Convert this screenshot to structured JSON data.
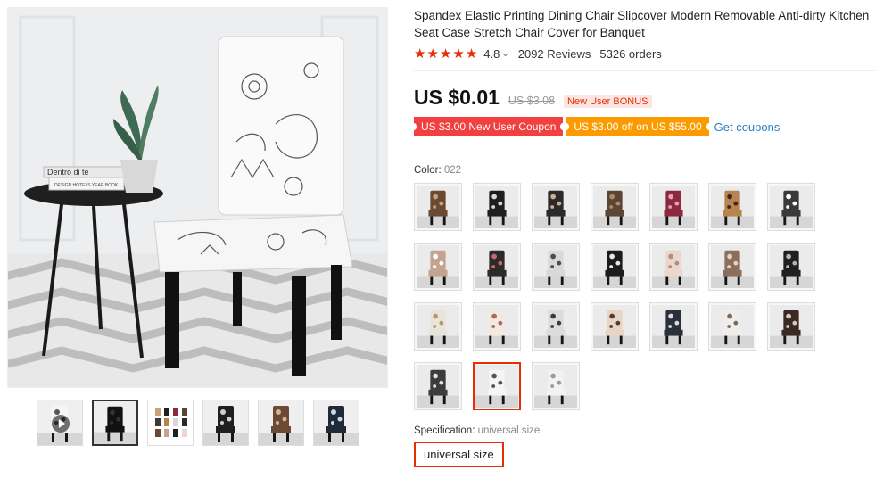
{
  "gallery": {
    "thumbnails": [
      {
        "name": "thumb-video",
        "kind": "video"
      },
      {
        "name": "thumb-black-chair",
        "kind": "image"
      },
      {
        "name": "thumb-size-chart",
        "kind": "image"
      },
      {
        "name": "thumb-floral-dark",
        "kind": "image"
      },
      {
        "name": "thumb-floral-brown",
        "kind": "image"
      },
      {
        "name": "thumb-floral-navy",
        "kind": "image"
      }
    ],
    "main_image_text": {
      "book_title": "Dentro di te",
      "book_subtitle": "DESIGN HOTELS YEAR BOOK"
    }
  },
  "product": {
    "title": "Spandex Elastic Printing Dining Chair Slipcover Modern Removable Anti-dirty Kitchen Seat Case Stretch Chair Cover for Banquet",
    "rating": "4.8",
    "rating_caret": "⌄",
    "reviews": "2092 Reviews",
    "orders": "5326 orders",
    "star_count": 5,
    "star_color": "#e62e04"
  },
  "price": {
    "current": "US $0.01",
    "original": "US $3.08",
    "bonus": "New User BONUS"
  },
  "coupons": {
    "items": [
      {
        "label": "US $3.00 New User Coupon",
        "color": "#f23f3f"
      },
      {
        "label": "US $3.00 off on US $55.00",
        "color": "#fb9b00"
      }
    ],
    "link": "Get coupons"
  },
  "color": {
    "label": "Color:",
    "value": "022",
    "options": [
      {
        "bg": "#6b4a34",
        "fg": "#c9a27a"
      },
      {
        "bg": "#1e1e1e",
        "fg": "#d9d9d9"
      },
      {
        "bg": "#2a2a2a",
        "fg": "#c8b08a"
      },
      {
        "bg": "#5b4636",
        "fg": "#b08b6a"
      },
      {
        "bg": "#8c2940",
        "fg": "#e5a0b5"
      },
      {
        "bg": "#b7834f",
        "fg": "#3a2a20"
      },
      {
        "bg": "#3a3a3a",
        "fg": "#ffffff"
      },
      {
        "bg": "#c4a48e",
        "fg": "#ffffff"
      },
      {
        "bg": "#2b2b2b",
        "fg": "#c76a6a"
      },
      {
        "bg": "#d9d9d9",
        "fg": "#4d4d4d"
      },
      {
        "bg": "#1c1c1c",
        "fg": "#e8e8e8"
      },
      {
        "bg": "#ead8cf",
        "fg": "#c08a7a"
      },
      {
        "bg": "#8c6e5a",
        "fg": "#e2d4c6"
      },
      {
        "bg": "#202020",
        "fg": "#b5b5b5"
      },
      {
        "bg": "#e8e4dc",
        "fg": "#b59a68"
      },
      {
        "bg": "#f2e9e1",
        "fg": "#a86a5a"
      },
      {
        "bg": "#dcdcdc",
        "fg": "#3a3a3a"
      },
      {
        "bg": "#e6d6c8",
        "fg": "#5b3a2a"
      },
      {
        "bg": "#2a2f3a",
        "fg": "#d9dce2"
      },
      {
        "bg": "#f0eeeb",
        "fg": "#7a6a5a"
      },
      {
        "bg": "#3a2a24",
        "fg": "#e0c8b8"
      },
      {
        "bg": "#3c3c3c",
        "fg": "#e0e0e0"
      },
      {
        "bg": "#f5f5f5",
        "fg": "#555555"
      },
      {
        "bg": "#f2f2f2",
        "fg": "#9a9a9a"
      }
    ],
    "selected_index": 22
  },
  "specification": {
    "label": "Specification:",
    "value": "universal size",
    "option": "universal size"
  }
}
